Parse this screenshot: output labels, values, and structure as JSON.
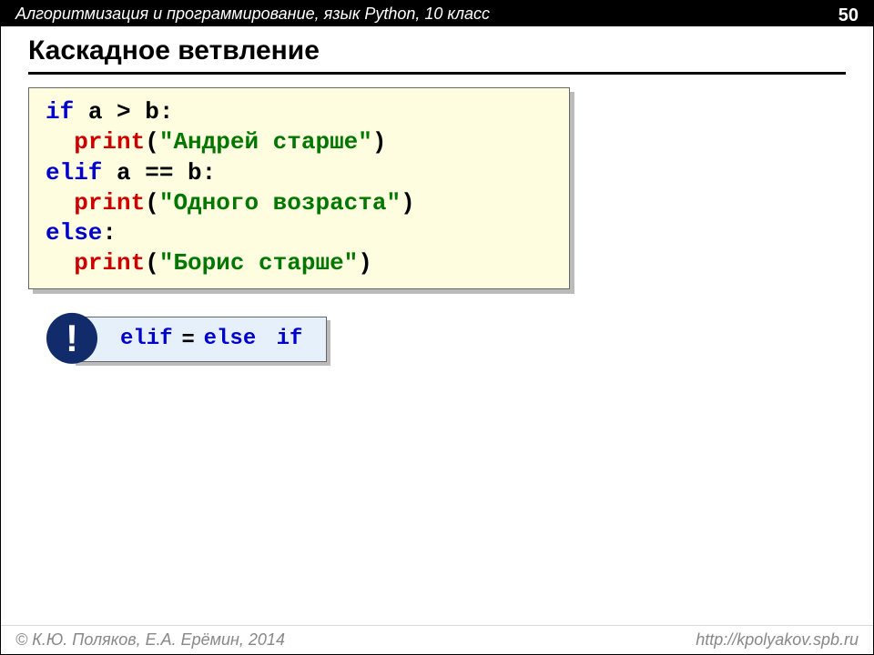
{
  "header": {
    "title": "Алгоритмизация и программирование, язык Python, 10 класс",
    "page": "50"
  },
  "slide": {
    "title": "Каскадное ветвление"
  },
  "code": {
    "l1_if": "if",
    "l1_rest": " a > b:",
    "l2_indent": "  ",
    "l2_fn": "print",
    "l2_paren_open": "(",
    "l2_str": "\"Андрей старше\"",
    "l2_paren_close": ")",
    "l3_elif": "elif",
    "l3_rest": " a == b:",
    "l4_indent": "  ",
    "l4_fn": "print",
    "l4_paren_open": "(",
    "l4_str": "\"Одного возраста\"",
    "l4_paren_close": ")",
    "l5_else": "else",
    "l5_colon": ":",
    "l6_indent": "  ",
    "l6_fn": "print",
    "l6_paren_open": "(",
    "l6_str": "\"Борис старше\"",
    "l6_paren_close": ")"
  },
  "note": {
    "bang": "!",
    "elif": "elif",
    "eq": "=",
    "else": "else",
    "if": "if"
  },
  "footer": {
    "left": "© К.Ю. Поляков, Е.А. Ерёмин, 2014",
    "right": "http://kpolyakov.spb.ru"
  }
}
